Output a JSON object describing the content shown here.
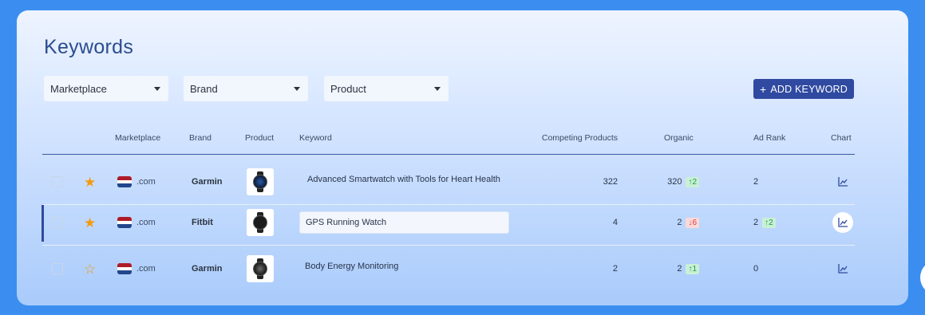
{
  "page": {
    "title": "Keywords"
  },
  "filters": [
    {
      "label": "Marketplace"
    },
    {
      "label": "Brand"
    },
    {
      "label": "Product"
    }
  ],
  "add_button": {
    "label": "ADD KEYWORD",
    "icon": "plus-icon"
  },
  "table": {
    "headers": {
      "marketplace": "Marketplace",
      "brand": "Brand",
      "product": "Product",
      "keyword": "Keyword",
      "competing": "Competing Products",
      "organic": "Organic",
      "ad_rank": "Ad Rank",
      "chart": "Chart"
    },
    "rows": [
      {
        "starred": true,
        "star_glyph": "★",
        "flag": [
          "#ae1c28",
          "#ffffff",
          "#21468b"
        ],
        "tld": ".com",
        "brand": "Garmin",
        "keyword": "Advanced Smartwatch with Tools for Heart Health",
        "competing": "322",
        "organic": "320",
        "organic_change": "↑2",
        "organic_dir": "up",
        "ad_rank": "2",
        "ad_change": "",
        "ad_dir": "",
        "selected": false
      },
      {
        "starred": true,
        "star_glyph": "★",
        "flag": [
          "#ae1c28",
          "#ffffff",
          "#21468b"
        ],
        "tld": ".com",
        "brand": "Fitbit",
        "keyword": "GPS Running Watch",
        "competing": "4",
        "organic": "2",
        "organic_change": "↓6",
        "organic_dir": "down",
        "ad_rank": "2",
        "ad_change": "↑2",
        "ad_dir": "up",
        "selected": true
      },
      {
        "starred": false,
        "star_glyph": "☆",
        "flag": [
          "#ae1c28",
          "#ffffff",
          "#21468b"
        ],
        "tld": ".com",
        "brand": "Garmin",
        "keyword": "Body Energy Monitoring",
        "competing": "2",
        "organic": "2",
        "organic_change": "↑1",
        "organic_dir": "up",
        "ad_rank": "0",
        "ad_change": "",
        "ad_dir": "",
        "selected": false
      }
    ]
  },
  "colors": {
    "page_background": "#3b8ef0",
    "accent": "#2f4aa0",
    "star": "#f59a0c",
    "up": "#1a9a4a",
    "down": "#e0393b"
  }
}
